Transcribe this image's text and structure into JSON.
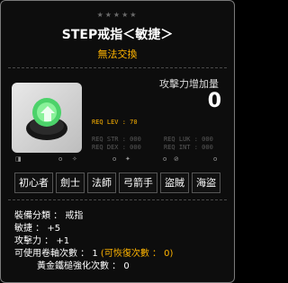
{
  "item": {
    "stars": "★★★★★",
    "title": "STEP戒指＜敏捷＞",
    "untradeable": "無法交換",
    "attack_label": "攻擊力增加量",
    "attack_value": "0",
    "req_lev": "REQ LEV :  70",
    "req_str": "REQ STR : 000",
    "req_dex": "REQ DEX : 000",
    "req_luk": "REQ LUK : 000",
    "req_int": "REQ INT : 000"
  },
  "flags": [
    "o",
    "o",
    "o",
    "o"
  ],
  "jobs": [
    "初心者",
    "劍士",
    "法師",
    "弓箭手",
    "盜賊",
    "海盜"
  ],
  "stats": {
    "category": "裝備分類 ： 戒指",
    "dex": "敏捷 ： +5",
    "attack": "攻擊力 ： +1",
    "scrolls_prefix": "可使用卷軸次數 ： 1",
    "scrolls_restore": "(可恢復次數 ： 0)",
    "hammer": "黃金鐵槌強化次數 ： 0"
  },
  "colors": {
    "accent": "#ffb400",
    "border": "#7a7a7a"
  }
}
